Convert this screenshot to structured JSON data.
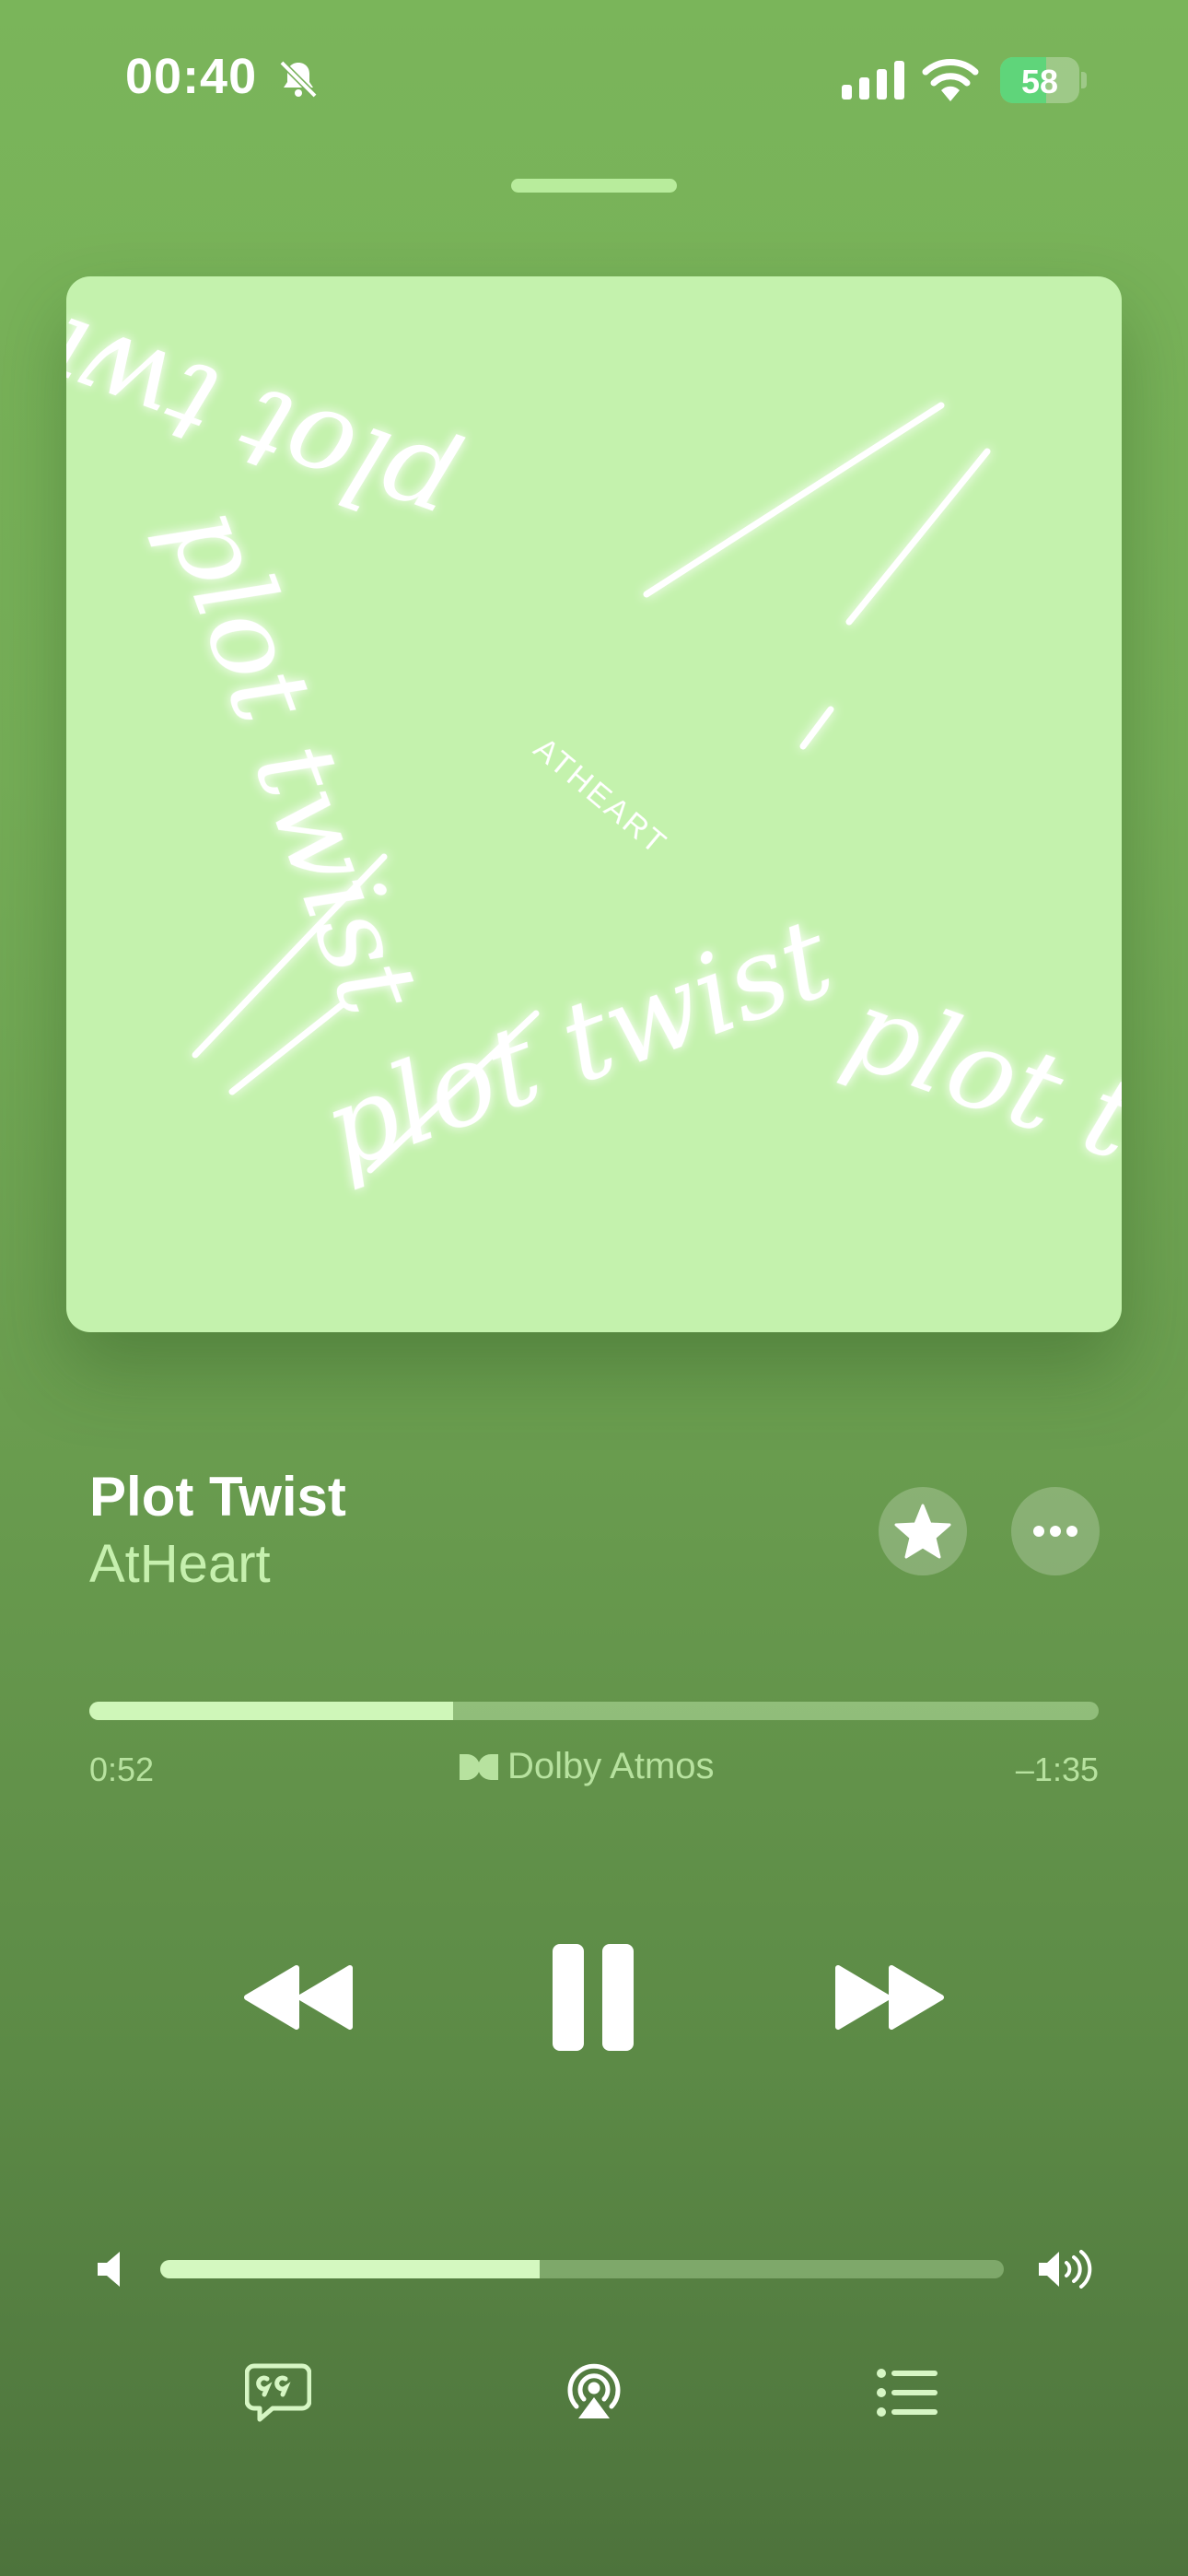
{
  "status_bar": {
    "time": "00:40",
    "battery": "58",
    "battery_level": 0.58
  },
  "artwork": {
    "center_text": "ATHEART",
    "loop_text": "plot twist"
  },
  "track": {
    "title": "Plot Twist",
    "artist": "AtHeart"
  },
  "playback": {
    "elapsed": "0:52",
    "remaining": "–1:35",
    "progress": 0.36,
    "format": "Dolby Atmos"
  },
  "volume": {
    "level": 0.45
  },
  "icons": {
    "silent": "bell-slash-icon",
    "signal": "cellular-signal-icon",
    "wifi": "wifi-icon",
    "favorite": "star-icon",
    "more": "ellipsis-icon",
    "rewind": "backward-icon",
    "pause": "pause-icon",
    "forward": "forward-icon",
    "volume_low": "speaker-low-icon",
    "volume_high": "speaker-high-icon",
    "lyrics": "quote-bubble-icon",
    "airplay": "airplay-icon",
    "queue": "list-icon"
  },
  "colors": {
    "background_top": "#7ab55a",
    "background_bottom": "#4d733c",
    "artwork_bg": "#c4f2ad",
    "accent_light": "#c6f0ae"
  }
}
